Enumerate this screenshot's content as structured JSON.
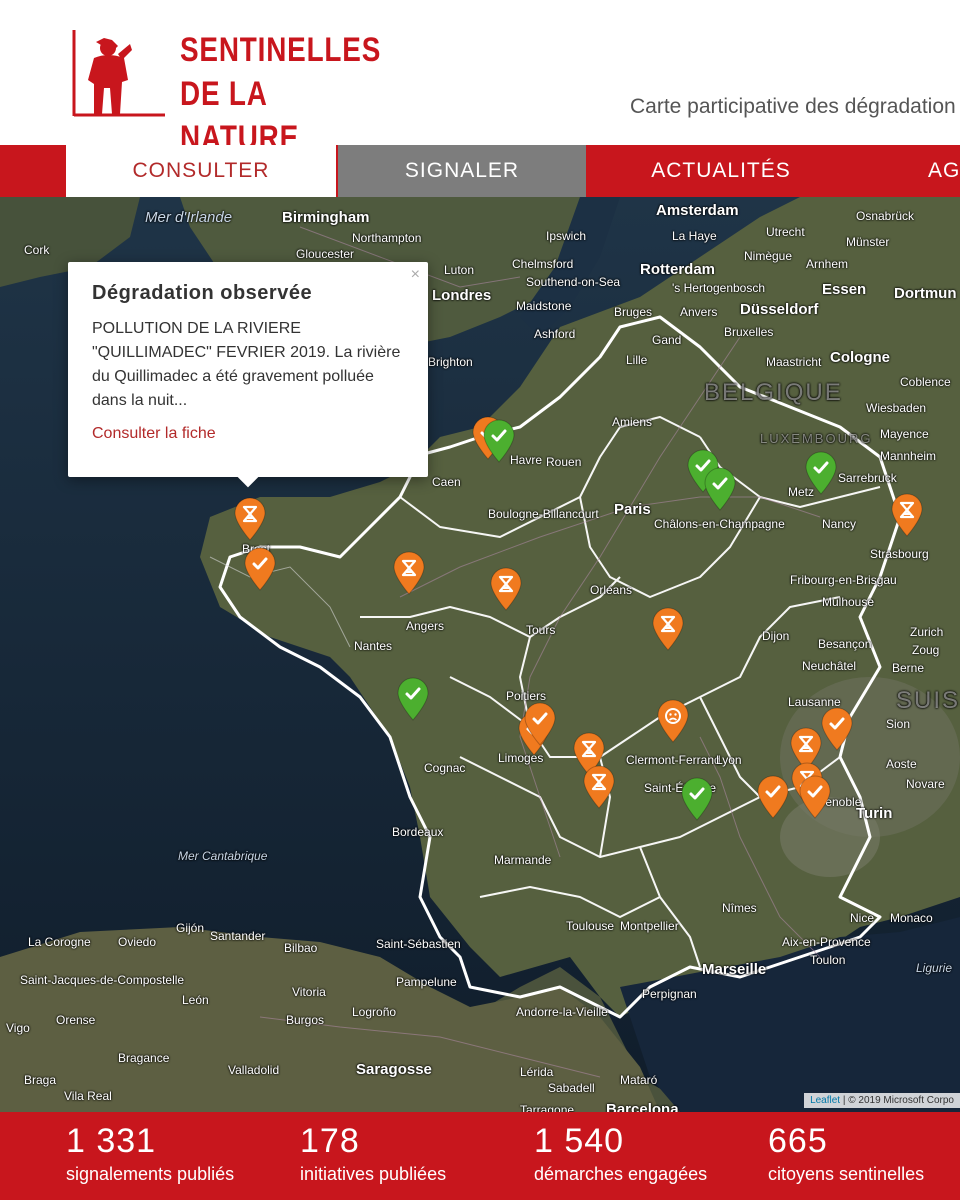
{
  "brand": {
    "line1": "SENTINELLES",
    "line2": "DE LA NATURE",
    "tagline": "Carte participative des dégradation",
    "color": "#c8161d"
  },
  "nav": {
    "consulter": "CONSULTER",
    "signaler": "SIGNALER",
    "actualites": "ACTUALITÉS",
    "agenda": "AG"
  },
  "popup": {
    "close": "×",
    "title": "Dégradation observée",
    "body": "POLLUTION DE LA RIVIERE \"QUILLIMADEC\" FEVRIER 2019. La rivière du Quillimadec a été gravement polluée dans la nuit...",
    "link": "Consulter la fiche"
  },
  "map": {
    "attribution_leaflet": "Leaflet",
    "attribution_rest": " | © 2019 Microsoft Corpo",
    "places": {
      "mer_irlande": "Mer d'Irlande",
      "birmingham": "Birmingham",
      "northampton": "Northampton",
      "gloucester": "Gloucester",
      "cork": "Cork",
      "ipswich": "Ipswich",
      "chelmsford": "Chelmsford",
      "southend": "Southend-on-Sea",
      "luton": "Luton",
      "londres": "Londres",
      "maidstone": "Maidstone",
      "ashford": "Ashford",
      "brighton": "Brighton",
      "amsterdam": "Amsterdam",
      "la_haye": "La Haye",
      "utrecht": "Utrecht",
      "rotterdam": "Rotterdam",
      "hertogenbosch": "'s Hertogenbosch",
      "nimegue": "Nimègue",
      "arnhem": "Arnhem",
      "munster": "Münster",
      "osnabruck": "Osnabrück",
      "essen": "Essen",
      "dortmund": "Dortmun",
      "dusseldorf": "Düsseldorf",
      "bruges": "Bruges",
      "anvers": "Anvers",
      "gand": "Gand",
      "bruxelles": "Bruxelles",
      "cologne": "Cologne",
      "maastricht": "Maastricht",
      "lille": "Lille",
      "belgique": "BELGIQUE",
      "amiens": "Amiens",
      "wiesbaden": "Wiesbaden",
      "coblence": "Coblence",
      "luxembourg": "LUXEMBOURG",
      "mayence": "Mayence",
      "mannheim": "Mannheim",
      "havre": "Havre",
      "rouen": "Rouen",
      "caen": "Caen",
      "metz": "Metz",
      "sarrebruck": "Sarrebruck",
      "boulogne": "Boulogne-Billancourt",
      "paris": "Paris",
      "chalons": "Châlons-en-Champagne",
      "nancy": "Nancy",
      "strasbourg": "Strasbourg",
      "brest": "Brest",
      "orleans": "Orléans",
      "fribourg": "Fribourg-en-Brisgau",
      "mulhouse": "Mulhouse",
      "angers": "Angers",
      "tours": "Tours",
      "nantes": "Nantes",
      "dijon": "Dijon",
      "besancon": "Besançon",
      "zurich": "Zurich",
      "zoug": "Zoug",
      "berne": "Berne",
      "neuchatel": "Neuchâtel",
      "poitiers": "Poitiers",
      "lausanne": "Lausanne",
      "suisse": "SUISSE",
      "limoges": "Limoges",
      "clermont": "Clermont-Ferrand",
      "lyon": "Lyon",
      "cognac": "Cognac",
      "saint_etienne": "Saint-Étienne",
      "grenoble": "Grenoble",
      "turin": "Turin",
      "aoste": "Aoste",
      "novare": "Novare",
      "sion": "Sion",
      "bordeaux": "Bordeaux",
      "mer_cantabrique": "Mer Cantabrique",
      "marmande": "Marmande",
      "nimes": "Nîmes",
      "nice": "Nice",
      "monaco": "Monaco",
      "toulouse": "Toulouse",
      "montpellier": "Montpellier",
      "aix": "Aix-en-Provence",
      "toulon": "Toulon",
      "marseille": "Marseille",
      "ligurie": "Ligurie",
      "la_corogne": "La Corogne",
      "oviedo": "Oviedo",
      "gijon": "Gijón",
      "santander": "Santander",
      "bilbao": "Bilbao",
      "saint_sebastien": "Saint-Sébastien",
      "saint_jacques": "Saint-Jacques-de-Compostelle",
      "vitoria": "Vitoria",
      "pampelune": "Pampelune",
      "leon": "León",
      "perpignan": "Perpignan",
      "burgos": "Burgos",
      "logrono": "Logroño",
      "andorre": "Andorre-la-Vieille",
      "vigo": "Vigo",
      "orense": "Orense",
      "bragance": "Bragance",
      "valladolid": "Valladolid",
      "saragosse": "Saragosse",
      "lerida": "Lérida",
      "mataro": "Mataró",
      "sabadell": "Sabadell",
      "braga": "Braga",
      "vila_real": "Vila Real",
      "tarragone": "Tarragone",
      "barcelone": "Barcelona"
    }
  },
  "stats": [
    {
      "value": "1 331",
      "label": "signalements publiés"
    },
    {
      "value": "178",
      "label": "initiatives publiées"
    },
    {
      "value": "1 540",
      "label": "démarches engagées"
    },
    {
      "value": "665",
      "label": "citoyens sentinelles"
    }
  ],
  "colors": {
    "red": "#c8161d",
    "grey_tab": "#7d7d7d",
    "marker_orange": "#f07a1f",
    "marker_green": "#4caf2f"
  },
  "markers": [
    {
      "kind": "orange",
      "icon": "hourglass-icon"
    },
    {
      "kind": "orange",
      "icon": "check-icon"
    },
    {
      "kind": "orange",
      "icon": "hourglass-icon"
    },
    {
      "kind": "orange",
      "icon": "hourglass-icon"
    },
    {
      "kind": "orange",
      "icon": "check-icon"
    },
    {
      "kind": "green",
      "icon": "check-icon"
    },
    {
      "kind": "green",
      "icon": "check-icon"
    },
    {
      "kind": "green",
      "icon": "check-icon"
    },
    {
      "kind": "green",
      "icon": "check-icon"
    },
    {
      "kind": "orange",
      "icon": "hourglass-icon"
    },
    {
      "kind": "orange",
      "icon": "hourglass-icon"
    },
    {
      "kind": "green",
      "icon": "check-icon"
    },
    {
      "kind": "orange",
      "icon": "check-icon"
    },
    {
      "kind": "orange",
      "icon": "check-icon"
    },
    {
      "kind": "orange",
      "icon": "sad-face-icon"
    },
    {
      "kind": "orange",
      "icon": "hourglass-icon"
    },
    {
      "kind": "orange",
      "icon": "hourglass-icon"
    },
    {
      "kind": "green",
      "icon": "check-icon"
    },
    {
      "kind": "orange",
      "icon": "check-icon"
    },
    {
      "kind": "orange",
      "icon": "check-icon"
    },
    {
      "kind": "orange",
      "icon": "hourglass-icon"
    },
    {
      "kind": "orange",
      "icon": "hourglass-icon"
    },
    {
      "kind": "orange",
      "icon": "check-icon"
    }
  ]
}
